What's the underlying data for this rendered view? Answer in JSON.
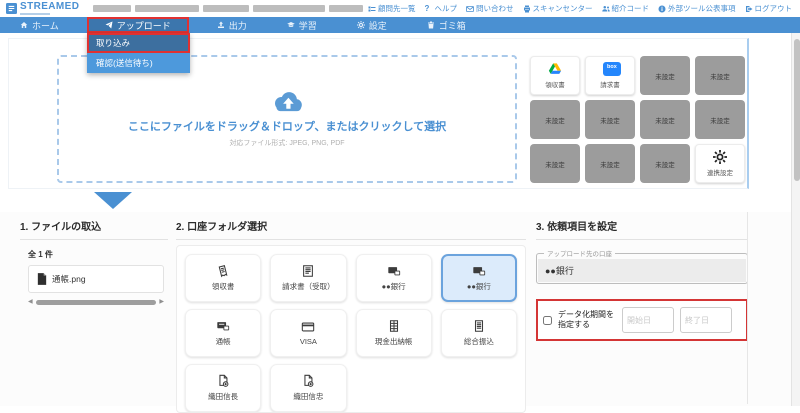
{
  "colors": {
    "primary": "#4a90d2",
    "annotation": "#e03131",
    "unset_cell": "#9c9c9c",
    "selected_folder_bg": "#dcebfb"
  },
  "header": {
    "logo_text": "STREAMED",
    "links": [
      {
        "label": "顧問先一覧",
        "icon": "clients"
      },
      {
        "label": "ヘルプ",
        "icon": "help"
      },
      {
        "label": "問い合わせ",
        "icon": "mail"
      },
      {
        "label": "スキャンセンター",
        "icon": "printer"
      },
      {
        "label": "紹介コード",
        "icon": "users"
      },
      {
        "label": "外部ツール公表事項",
        "icon": "info"
      },
      {
        "label": "ログアウト",
        "icon": "logout"
      }
    ]
  },
  "navbar": {
    "items": [
      {
        "label": "ホーム",
        "icon": "home"
      },
      {
        "label": "アップロード",
        "icon": "plane",
        "active": true
      },
      {
        "label": "出力",
        "icon": "output"
      },
      {
        "label": "学習",
        "icon": "learn"
      },
      {
        "label": "設定",
        "icon": "gear"
      },
      {
        "label": "ゴミ箱",
        "icon": "trash"
      }
    ],
    "dropdown": [
      {
        "label": "取り込み",
        "active": true
      },
      {
        "label": "確認(送信待ち)"
      }
    ]
  },
  "dropzone": {
    "icon": "cloud",
    "main_text": "ここにファイルをドラッグ＆ドロップ、またはクリックして選択",
    "sub_text": "対応ファイル形式: JPEG, PNG, PDF"
  },
  "integrations": {
    "cells": [
      {
        "label": "領収書",
        "icon": "gdrive",
        "state": "configured"
      },
      {
        "label": "請求書",
        "icon": "box",
        "state": "configured"
      },
      {
        "label": "未設定",
        "state": "unset"
      },
      {
        "label": "未設定",
        "state": "unset"
      },
      {
        "label": "未設定",
        "state": "unset"
      },
      {
        "label": "未設定",
        "state": "unset"
      },
      {
        "label": "未設定",
        "state": "unset"
      },
      {
        "label": "未設定",
        "state": "unset"
      },
      {
        "label": "未設定",
        "state": "unset"
      },
      {
        "label": "未設定",
        "state": "unset"
      },
      {
        "label": "未設定",
        "state": "unset"
      },
      {
        "label": "連携設定",
        "icon": "gear",
        "state": "settings"
      }
    ]
  },
  "section1": {
    "title": "1. ファイルの取込",
    "count": "全 1 件",
    "files": [
      {
        "name": "通帳.png",
        "icon": "file"
      }
    ]
  },
  "section2": {
    "title": "2. 口座フォルダ選択",
    "folders": [
      {
        "label": "領収書",
        "icon": "receipt"
      },
      {
        "label": "請求書（受取）",
        "icon": "invoice"
      },
      {
        "label": "●●銀行",
        "icon": "bank"
      },
      {
        "label": "●●銀行",
        "icon": "bank",
        "selected": true
      },
      {
        "label": "通帳",
        "icon": "passbook"
      },
      {
        "label": "VISA",
        "icon": "card"
      },
      {
        "label": "現金出納帳",
        "icon": "ledger"
      },
      {
        "label": "総合振込",
        "icon": "doc"
      },
      {
        "label": "織田信長",
        "icon": "filegear"
      },
      {
        "label": "織田信忠",
        "icon": "filegear"
      }
    ]
  },
  "section3": {
    "title": "3. 依頼項目を設定",
    "account_label": "アップロード先の口座",
    "account_value": "●●銀行",
    "period_checkbox_label": "データ化期間を指定する",
    "start_placeholder": "開始日",
    "end_placeholder": "終了日"
  }
}
